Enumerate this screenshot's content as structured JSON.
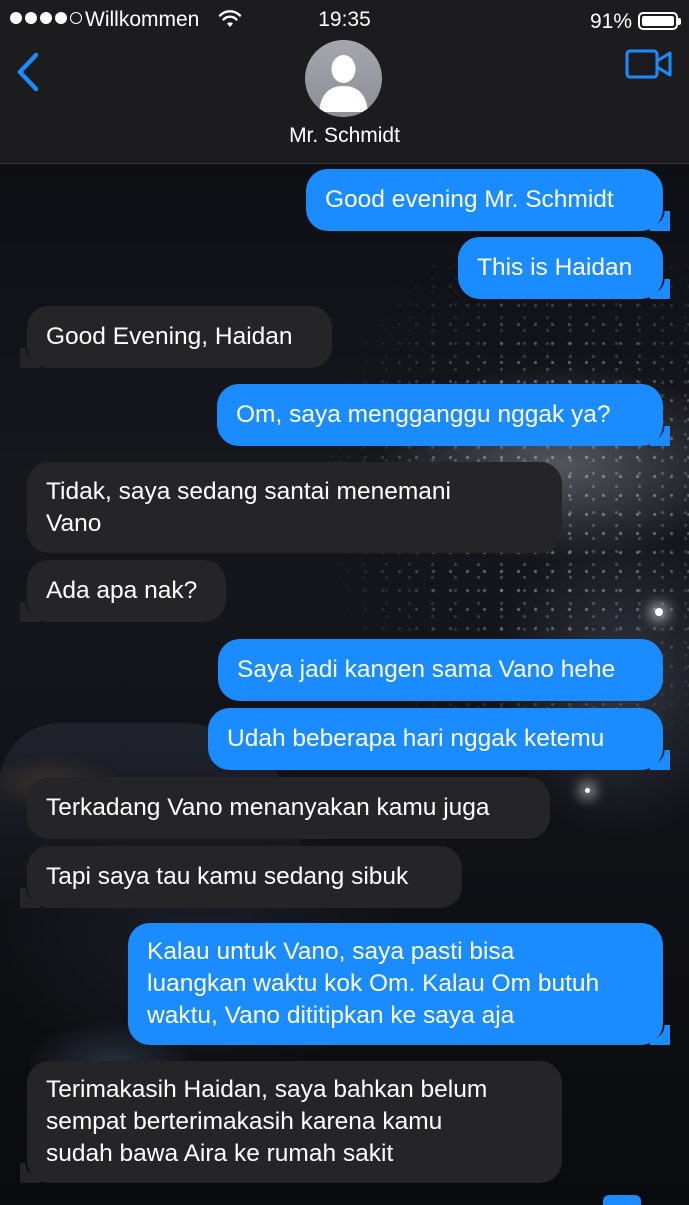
{
  "status_bar": {
    "carrier": "Willkommen",
    "time": "19:35",
    "battery": "91%"
  },
  "header": {
    "contact_name": "Mr. Schmidt",
    "icons": [
      "back-chevron-icon",
      "avatar-silhouette-icon",
      "video-call-icon",
      "wifi-icon",
      "battery-icon",
      "signal-dots-icon"
    ]
  },
  "colors": {
    "sent_bubble": "#1a8cff",
    "received_bubble": "#252527",
    "header_bg": "#1c1c1e",
    "accent": "#1a8cff"
  },
  "messages": [
    {
      "from": "me",
      "lines": [
        "Good evening Mr. Schmidt"
      ]
    },
    {
      "from": "me",
      "lines": [
        "This is Haidan"
      ]
    },
    {
      "from": "them",
      "lines": [
        "Good Evening, Haidan"
      ]
    },
    {
      "from": "me",
      "lines": [
        "Om, saya mengganggu nggak ya?"
      ]
    },
    {
      "from": "them",
      "lines": [
        "Tidak, saya sedang santai menemani",
        "Vano"
      ]
    },
    {
      "from": "them",
      "lines": [
        "Ada apa nak?"
      ]
    },
    {
      "from": "me",
      "lines": [
        "Saya jadi kangen sama Vano hehe"
      ]
    },
    {
      "from": "me",
      "lines": [
        "Udah beberapa hari nggak ketemu"
      ]
    },
    {
      "from": "them",
      "lines": [
        "Terkadang Vano menanyakan kamu juga"
      ]
    },
    {
      "from": "them",
      "lines": [
        "Tapi saya tau kamu sedang sibuk"
      ]
    },
    {
      "from": "me",
      "lines": [
        "Kalau untuk Vano, saya pasti bisa",
        "luangkan waktu kok Om. Kalau Om butuh",
        "waktu, Vano dititipkan ke saya aja"
      ]
    },
    {
      "from": "them",
      "lines": [
        "Terimakasih Haidan, saya bahkan belum",
        "sempat berterimakasih karena kamu",
        "sudah bawa Aira ke rumah sakit"
      ]
    }
  ]
}
